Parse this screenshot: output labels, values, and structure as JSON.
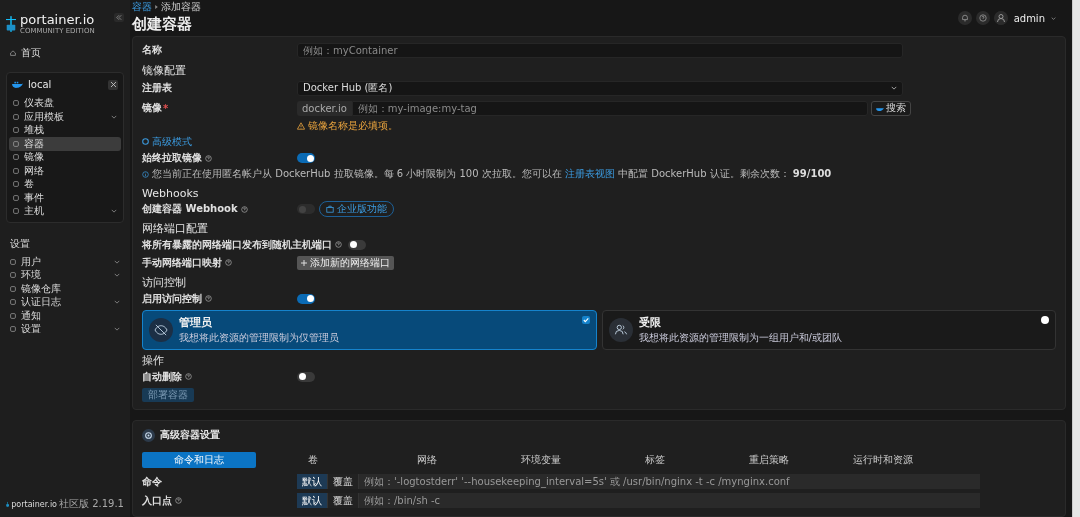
{
  "sidebar": {
    "logo": "portainer.io",
    "logo_sub": "COMMUNITY EDITION",
    "home": {
      "label": "首页",
      "selected": false
    },
    "environment": {
      "name": "local",
      "items": [
        {
          "label": "仪表盘",
          "selected": false,
          "expandable": false
        },
        {
          "label": "应用模板",
          "selected": false,
          "expandable": true
        },
        {
          "label": "堆栈",
          "selected": false,
          "expandable": false
        },
        {
          "label": "容器",
          "selected": true,
          "expandable": false
        },
        {
          "label": "镜像",
          "selected": false,
          "expandable": false
        },
        {
          "label": "网络",
          "selected": false,
          "expandable": false
        },
        {
          "label": "卷",
          "selected": false,
          "expandable": false
        },
        {
          "label": "事件",
          "selected": false,
          "expandable": false
        },
        {
          "label": "主机",
          "selected": false,
          "expandable": true
        }
      ]
    },
    "settings_title": "设置",
    "settings_items": [
      {
        "label": "用户",
        "selected": false,
        "expandable": true
      },
      {
        "label": "环境",
        "selected": false,
        "expandable": true
      },
      {
        "label": "镜像仓库",
        "selected": false,
        "expandable": false
      },
      {
        "label": "认证日志",
        "selected": false,
        "expandable": true
      },
      {
        "label": "通知",
        "selected": false,
        "expandable": false
      },
      {
        "label": "设置",
        "selected": false,
        "expandable": true
      }
    ],
    "footer": {
      "brand": "portainer.io",
      "edition": "社区版 2.19.1"
    }
  },
  "header": {
    "breadcrumb": [
      "容器",
      "添加容器"
    ],
    "title": "创建容器",
    "user": "admin"
  },
  "form": {
    "name": {
      "label": "名称",
      "placeholder": "例如：myContainer"
    },
    "image_section": "镜像配置",
    "registry": {
      "label": "注册表",
      "value": "Docker Hub (匿名)"
    },
    "image": {
      "label": "镜像",
      "required_mark": "*",
      "prefix": "docker.io",
      "placeholder": "例如：my-image:my-tag",
      "search_button": "搜索",
      "warning": "镜像名称是必填项。"
    },
    "advanced_link": "高级模式",
    "always_pull": {
      "label": "始终拉取镜像",
      "on": true
    },
    "pull_info": {
      "before": "您当前正在使用匿名帐户从 DockerHub 拉取镜像。每 6 小时限制为 100 次拉取。您可以在",
      "link": "注册表视图",
      "after": "中配置 DockerHub 认证。剩余次数：",
      "count": "99/100"
    },
    "webhooks_section": "Webhooks",
    "webhook": {
      "label": "创建容器 Webhook",
      "on": false,
      "disabled": true,
      "badge": "企业版功能"
    },
    "ports_section": "网络端口配置",
    "publish_all": {
      "label": "将所有暴露的网络端口发布到随机主机端口",
      "on": false
    },
    "manual_ports": {
      "label": "手动网络端口映射",
      "button": "添加新的网络端口"
    },
    "access_section": "访问控制",
    "access_enable": {
      "label": "启用访问控制",
      "on": true
    },
    "access_options": [
      {
        "title": "管理员",
        "description": "我想将此资源的管理限制为仅管理员",
        "selected": true
      },
      {
        "title": "受限",
        "description": "我想将此资源的管理限制为一组用户和/或团队",
        "selected": false
      }
    ],
    "actions_section": "操作",
    "auto_remove": {
      "label": "自动删除",
      "on": false
    },
    "deploy_button": {
      "label": "部署容器",
      "disabled": true
    }
  },
  "advanced": {
    "title": "高级容器设置",
    "tabs": [
      {
        "label": "命令和日志",
        "selected": true
      },
      {
        "label": "卷",
        "selected": false
      },
      {
        "label": "网络",
        "selected": false
      },
      {
        "label": "环境变量",
        "selected": false
      },
      {
        "label": "标签",
        "selected": false
      },
      {
        "label": "重启策略",
        "selected": false
      },
      {
        "label": "运行时和资源",
        "selected": false
      }
    ],
    "rows": [
      {
        "label": "命令",
        "help": false,
        "modes": [
          {
            "label": "默认",
            "selected": true
          },
          {
            "label": "覆盖",
            "selected": false
          }
        ],
        "placeholder": "例如：'-logtostderr' '--housekeeping_interval=5s' 或 /usr/bin/nginx -t -c /mynginx.conf"
      },
      {
        "label": "入口点",
        "help": true,
        "modes": [
          {
            "label": "默认",
            "selected": true
          },
          {
            "label": "覆盖",
            "selected": false
          }
        ],
        "placeholder": "例如：/bin/sh -c"
      }
    ]
  }
}
